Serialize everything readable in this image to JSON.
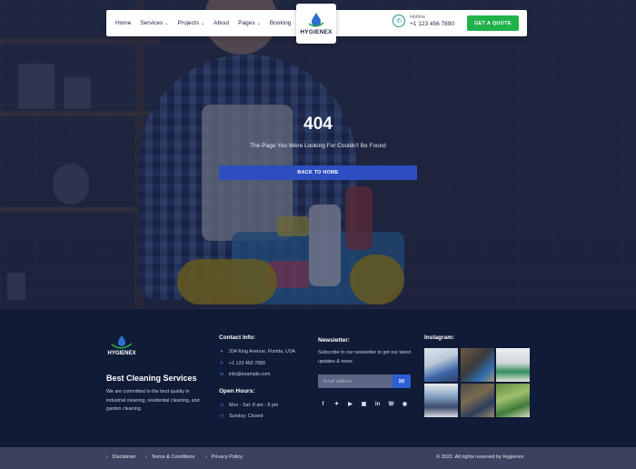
{
  "nav": {
    "items": [
      {
        "label": "Home",
        "dropdown": false
      },
      {
        "label": "Services",
        "dropdown": true
      },
      {
        "label": "Projects",
        "dropdown": true
      },
      {
        "label": "About",
        "dropdown": false
      },
      {
        "label": "Pages",
        "dropdown": true
      },
      {
        "label": "Booking",
        "dropdown": false
      }
    ],
    "logo_text": "HYGIENEX",
    "hotline_label": "Hotline",
    "hotline_number": "+1 123 456 7890",
    "quote_button": "GET A QUOTE"
  },
  "hero": {
    "code": "404",
    "message": "The Page You Were Looking For Couldn't Be Found",
    "back_button": "BACK TO HOME"
  },
  "footer": {
    "logo_text": "HYGIENEX",
    "title": "Best Cleaning Services",
    "description": "We are committed to the best quality in industrial cleaning, residential cleaning, and garden cleaning.",
    "contact": {
      "heading": "Contact Info:",
      "address": "334 King Avenue, Florida, USA",
      "phone": "+1 123 456 7890",
      "email": "info@example.com"
    },
    "hours": {
      "heading": "Open Hours:",
      "weekdays": "Mon - Sat: 8 am - 8 pm",
      "sunday": "Sunday: Closed"
    },
    "newsletter": {
      "heading": "Newsletter:",
      "description": "Subscribe to our newsletter to get our latest updates & news.",
      "placeholder": "Email address"
    },
    "socials": [
      "facebook-icon",
      "twitter-icon",
      "youtube-icon",
      "instagram-icon",
      "linkedin-icon",
      "whatsapp-icon",
      "messenger-icon"
    ],
    "instagram": {
      "heading": "Instagram:"
    }
  },
  "bottom": {
    "links": [
      "Disclaimer",
      "Terms & Conditions",
      "Privacy Policy"
    ],
    "copyright": "© 2022. All rights reserved by Hygienex"
  },
  "colors": {
    "primary_blue": "#2c4ec0",
    "green": "#21b24b",
    "footer_bg": "#101b37",
    "bottom_bar": "#3a4260"
  }
}
